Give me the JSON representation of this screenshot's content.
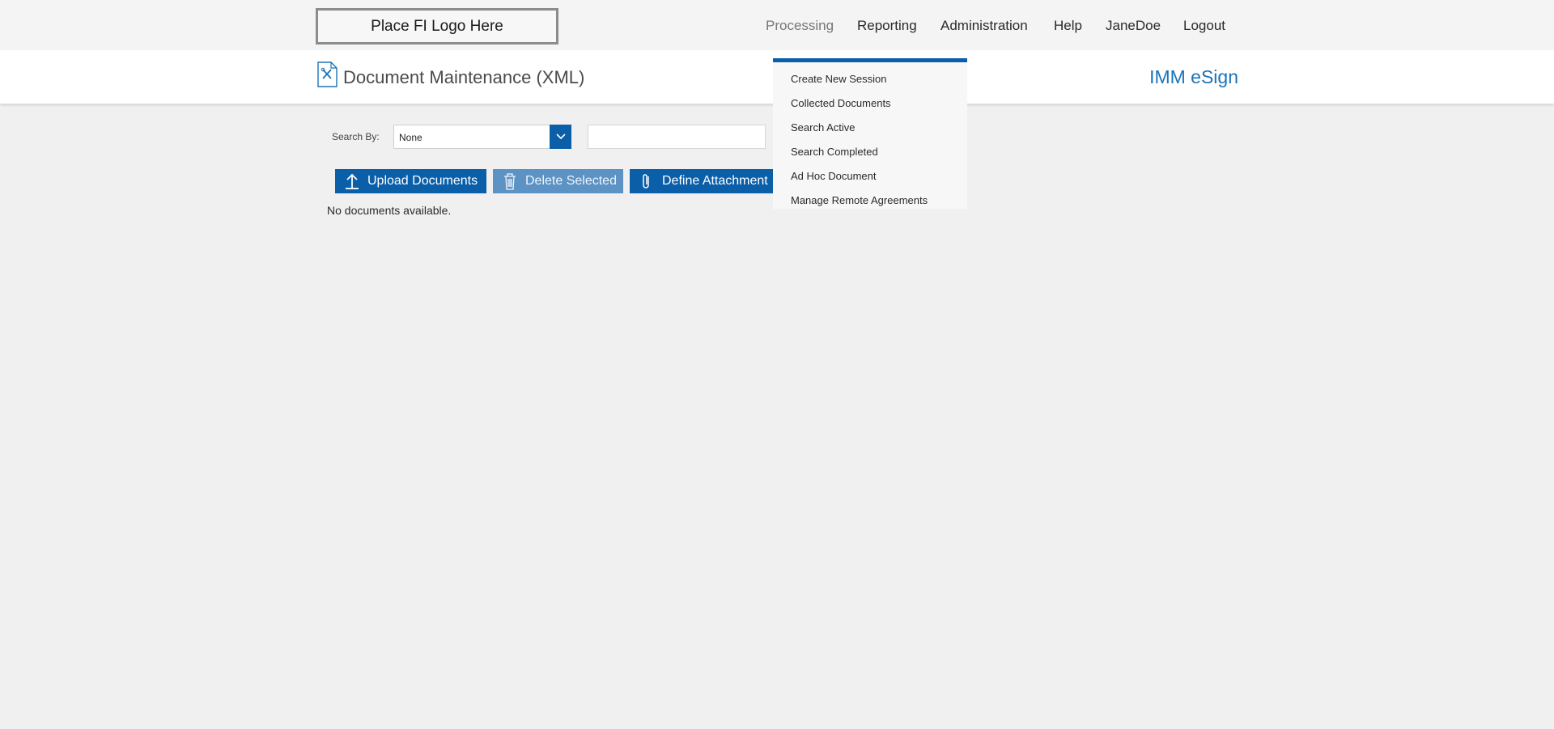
{
  "header": {
    "logo_text": "Place FI Logo Here",
    "nav": [
      {
        "label": "Processing",
        "active": true
      },
      {
        "label": "Reporting"
      },
      {
        "label": "Administration"
      },
      {
        "label": "Help"
      },
      {
        "label": "JaneDoe"
      },
      {
        "label": "Logout"
      }
    ]
  },
  "titlebar": {
    "page_title": "Document Maintenance (XML)",
    "brand": "IMM eSign"
  },
  "search": {
    "label": "Search By:",
    "select_value": "None",
    "input_value": ""
  },
  "toolbar": {
    "upload_label": "Upload Documents",
    "delete_label": "Delete Selected",
    "define_label": "Define Attachment"
  },
  "content": {
    "empty_message": "No documents available."
  },
  "processing_menu": {
    "items": [
      "Create New Session",
      "Collected Documents",
      "Search Active",
      "Search Completed",
      "Ad Hoc Document",
      "Manage Remote Agreements"
    ]
  },
  "colors": {
    "accent": "#0b5ea8",
    "accent_disabled": "#5c93c4",
    "brand_text": "#1b74b8",
    "page_bg": "#f0f0f0"
  },
  "icons": {
    "doc": "document-tools-icon",
    "select": "chevron-down-icon",
    "upload": "upload-arrow-icon",
    "delete": "trash-icon",
    "attach": "paperclip-icon"
  }
}
